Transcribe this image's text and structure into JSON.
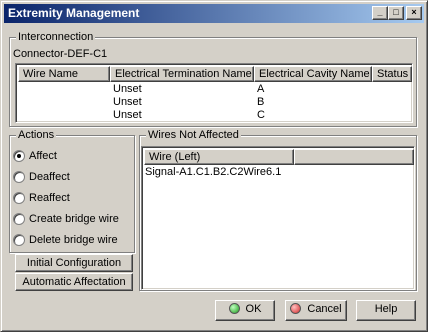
{
  "window": {
    "title": "Extremity Management",
    "minimize_glyph": "_",
    "maximize_glyph": "□",
    "close_glyph": "×"
  },
  "interconnection": {
    "group_label": "Interconnection",
    "connector_name": "Connector-DEF-C1",
    "columns": [
      "Wire Name",
      "Electrical Termination Name",
      "Electrical Cavity Name",
      "Status"
    ],
    "rows": [
      {
        "wire": "",
        "termination": "Unset",
        "cavity": "A",
        "status": ""
      },
      {
        "wire": "",
        "termination": "Unset",
        "cavity": "B",
        "status": ""
      },
      {
        "wire": "",
        "termination": "Unset",
        "cavity": "C",
        "status": ""
      }
    ]
  },
  "actions": {
    "group_label": "Actions",
    "options": [
      {
        "label": "Affect",
        "checked": true
      },
      {
        "label": "Deaffect",
        "checked": false
      },
      {
        "label": "Reaffect",
        "checked": false
      },
      {
        "label": "Create bridge wire",
        "checked": false
      },
      {
        "label": "Delete bridge wire",
        "checked": false
      }
    ],
    "initial_configuration_label": "Initial Configuration",
    "automatic_affectation_label": "Automatic Affectation"
  },
  "wires_not_affected": {
    "group_label": "Wires Not Affected",
    "column_header": "Wire (Left)",
    "items": [
      "Signal-A1.C1.B2.C2Wire6.1"
    ]
  },
  "footer": {
    "ok_label": "OK",
    "cancel_label": "Cancel",
    "help_label": "Help",
    "ok_color": "#1a9a1a",
    "cancel_color": "#d42a2a"
  }
}
